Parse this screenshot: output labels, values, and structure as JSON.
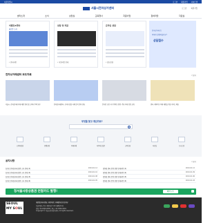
{
  "topbar": {
    "left_text": "서울특별시",
    "right_items": [
      "로그인",
      "회원가입",
      "사이트맵"
    ]
  },
  "header": {
    "logo_text": "서울시전자상가센터",
    "util": [
      "로그인",
      "회원가입"
    ]
  },
  "nav": {
    "items": [
      "센터소개",
      "소식",
      "상담실",
      "교육행사",
      "지원사업",
      "참여마당",
      "자료실"
    ]
  },
  "cards": [
    {
      "title": "이벤트&행사",
      "tag": "새로운 소식",
      "cap": "• 안내사항"
    },
    {
      "title": "상담 및 지원",
      "tag": "",
      "cap": "• 지원사업 안내"
    },
    {
      "title": "온라인 상담",
      "tag": "",
      "cap": "• 상담신청"
    }
  ],
  "promo": {
    "title": "전자상거래 등",
    "subtitle": "피해가 발생하셨나요?",
    "button": "상담접수"
  },
  "sections": {
    "press": {
      "title": "전자상거래센터 보도자료",
      "more": "더보기"
    },
    "notice": {
      "title": "공지사항",
      "more": "더보기"
    }
  },
  "news": [
    {
      "text": "서울시, 전자상거래 피해 예방 안내 및 소비자 주의 당부"
    },
    {
      "text": "전자상거래센터, 소비자 상담 사례 분석 결과 발표"
    },
    {
      "text": "온라인 쇼핑 사기 주의보 발령, 주요 피해 유형 공개"
    },
    {
      "text": "센터, 해외직구 피해 예방을 위한 가이드 배포"
    }
  ],
  "search": {
    "title": "무엇을 찾고 계신가요?",
    "placeholder": ""
  },
  "quick_links": [
    {
      "label": "소비자상담"
    },
    {
      "label": "분쟁조정"
    },
    {
      "label": "피해사례"
    },
    {
      "label": "자주하는질문"
    },
    {
      "label": "교육신청"
    },
    {
      "label": "자료실"
    },
    {
      "label": "오시는길"
    }
  ],
  "notice_left": [
    {
      "title": "[공지] 전자상거래 관련 소식 안내 (1)",
      "date": "2024.01.12"
    },
    {
      "title": "[공지] 전자상거래 관련 소식 안내 (2)",
      "date": "2024.01.10"
    },
    {
      "title": "[공지] 전자상거래 관련 소식 안내 (3)",
      "date": "2024.01.08"
    },
    {
      "title": "[공지] 전자상거래 관련 소식 안내 (4)",
      "date": "2024.01.05"
    }
  ],
  "notice_right": [
    {
      "title": "[안내] 센터 운영 관련 안내사항 (1)",
      "date": "2024.01.12"
    },
    {
      "title": "[안내] 센터 운영 관련 안내사항 (2)",
      "date": "2024.01.09"
    },
    {
      "title": "[안내] 센터 운영 관련 안내사항 (3)",
      "date": "2024.01.06"
    },
    {
      "title": "[안내] 센터 운영 관련 안내사항 (4)",
      "date": "2024.01.03"
    }
  ],
  "banner": {
    "text": "청서울사랑상품권 연말카드 발행!",
    "button": "혜택 모두"
  },
  "footer": {
    "logo_line1": "SEOUL",
    "logo_line2_prefix": "MY S",
    "logo_line2_o": "O",
    "logo_line2_suffix": "UL",
    "links": "개인정보처리방침 | 이용약관 | 이메일무단수집거부",
    "address": "서울특별시 중구 세종대로 110 (태평로1가)",
    "contact": "전화: 02-0000-0000 | 팩스: 02-0000-0001",
    "copyright": "Copyright © 서울시전자상가센터. All rights reserved."
  },
  "colors": {
    "primary": "#1b4aa3",
    "banner_green": "#1aa55e"
  }
}
